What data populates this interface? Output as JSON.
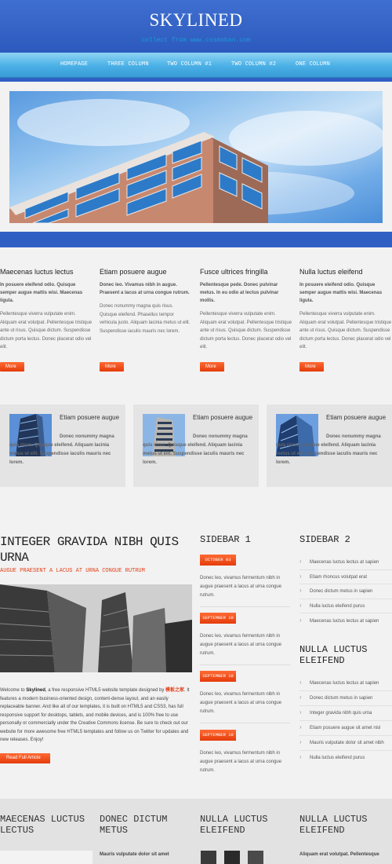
{
  "header": {
    "site_title": "SKYLINED",
    "tagline": "collect from www.cssmoban.com"
  },
  "nav": [
    {
      "label": "HOMEPAGE"
    },
    {
      "label": "THREE COLUMN"
    },
    {
      "label": "TWO COLUMN #1"
    },
    {
      "label": "TWO COLUMN #2"
    },
    {
      "label": "ONE COLUMN"
    }
  ],
  "columns": [
    {
      "title": "Maecenas luctus lectus",
      "lead": "In posuere eleifend odio. Quisque semper augue mattis wisi. Maecenas ligula.",
      "body": "Pellentesque viverra vulputate enim. Aliquam erat volutpat. Pellentesque tristique ante ut risus. Quisque dictum. Suspendisse dictum porta lectus. Donec placerat odio vel elit.",
      "button": "More"
    },
    {
      "title": "Etiam posuere augue",
      "lead": "Donec leo. Vivamus nibh in augue. Praesent a lacus at urna congue rutrum.",
      "body": "Donec nonummy magna quis risus. Quisque eleifend. Phasellus tempor vehicula justo. Aliquam lacinia metus ut elit. Suspendisse iaculis mauris nec lorem.",
      "button": "More"
    },
    {
      "title": "Fusce ultrices fringilla",
      "lead": "Pellentesque pede. Donec pulvinar metus. In eu odio at lectus pulvinar mollis.",
      "body": "Pellentesque viverra vulputate enim. Aliquam erat volutpat. Pellentesque tristique ante ut risus. Quisque dictum. Suspendisse dictum porta lectus. Donec placerat odio vel elit.",
      "button": "More"
    },
    {
      "title": "Nulla luctus eleifend",
      "lead": "In posuere eleifend odio. Quisque semper augue mattis wisi. Maecenas ligula.",
      "body": "Pellentesque viverra vulputate enim. Aliquam erat volutpat. Pellentesque tristique ante ut risus. Quisque dictum. Suspendisse dictum porta lectus. Donec placerat odio vel elit.",
      "button": "More"
    }
  ],
  "featured": [
    {
      "title": "Etiam posuere augue",
      "text": "Donec nonummy magna quis risus. Quisque eleifend. Aliquam lacinia metus ut elit. Suspendisse iaculis mauris nec lorem."
    },
    {
      "title": "Etiam posuere augue",
      "text": "Donec nonummy magna quis risus. Quisque eleifend. Aliquam lacinia metus ut elit. Suspendisse iaculis mauris nec lorem."
    },
    {
      "title": "Etiam posuere augue",
      "text": "Donec nonummy magna quis risus. Quisque eleifend. Aliquam lacinia metus ut elit. Suspendisse iaculis mauris nec lorem."
    }
  ],
  "article": {
    "title": "INTEGER GRAVIDA NIBH QUIS URNA",
    "subtitle": "AUGUE PRAESENT A LACUS AT URNA CONGUE RUTRUM",
    "text_pre": "Welcome to ",
    "text_brand": "Skylined",
    "text_mid": ", a free responsive HTML5 website template designed by ",
    "text_link": "模板之家",
    "text_post": ". It features a modern business-oriented design, content-dense layout, and an easily replaceable banner. And like all of our templates, it is built on HTML5 and CSS3, has full responsive support for desktops, tablets, and mobile devices, and is 100% free to use personally or commercially under the Creative Commons license. Be sure to check out our website for more awesome free HTML5 templates and follow us on Twitter for updates and new releases. Enjoy!",
    "button": "Read Full Article"
  },
  "sidebar1": {
    "title": "SIDEBAR 1",
    "items": [
      {
        "date": "OCTOBER 03",
        "text": "Donec leo, vivamus fermentum nibh in augue praesent a lacus at urna congue rutrum."
      },
      {
        "date": "SEPTEMBER 10",
        "text": "Donec leo, vivamus fermentum nibh in augue praesent a lacus at urna congue rutrum."
      },
      {
        "date": "SEPTEMBER 10",
        "text": "Donec leo, vivamus fermentum nibh in augue praesent a lacus at urna congue rutrum."
      },
      {
        "date": "SEPTEMBER 10",
        "text": "Donec leo, vivamus fermentum nibh in augue praesent a lacus at urna congue rutrum."
      }
    ]
  },
  "sidebar2": {
    "title": "SIDEBAR 2",
    "links1": [
      "Maecenas luctus lectus at sapien",
      "Etiam rhoncus volutpat erat",
      "Donec dictum metus in sapien",
      "Nulla luctus eleifend purus",
      "Maecenas luctus lectus at sapien"
    ],
    "title2": "NULLA LUCTUS ELEIFEND",
    "links2": [
      "Maecenas luctus lectus at sapien",
      "Donec dictum metus in sapien",
      "Integer gravida nibh quis urna",
      "Etiam posuere augue sit amet nisl",
      "Mauris vulputate dolor sit amet nibh",
      "Nulla luctus eleifend purus"
    ]
  },
  "footer": {
    "headings": [
      "MAECENAS LUCTUS LECTUS",
      "DONEC DICTUM METUS",
      "NULLA LUCTUS ELEIFEND",
      "NULLA LUCTUS ELEIFEND"
    ],
    "text2": "Mauris vulputate dolor sit amet",
    "text4": "Aliquam erat volutpat. Pellentesque"
  },
  "colors": {
    "header_blue": "#2f5fc3",
    "nav_cyan": "#4ab0e6",
    "accent_orange": "#e3431a"
  }
}
